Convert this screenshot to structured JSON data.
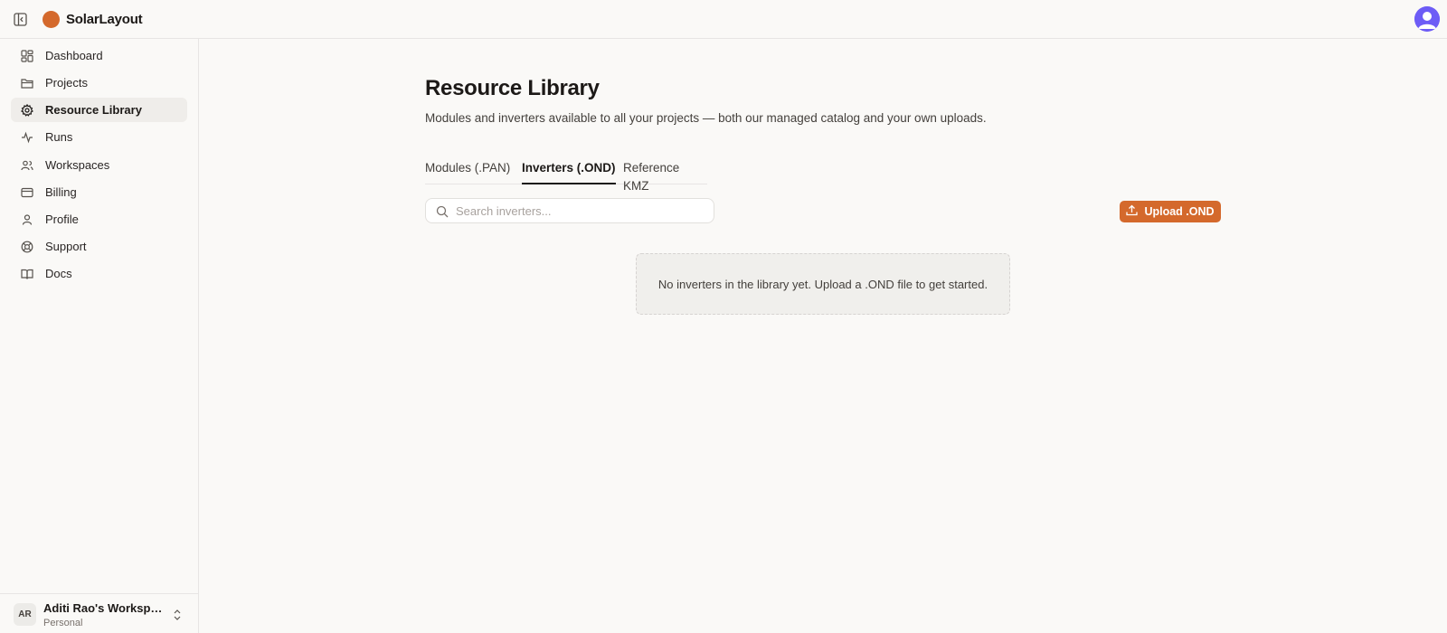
{
  "app": {
    "title": "SolarLayout",
    "brand_color": "#d4692c"
  },
  "header": {
    "sidebar_toggle_icon": "sidebar-toggle-icon",
    "user_avatar_color": "#6d5cf6"
  },
  "sidebar": {
    "items": [
      {
        "label": "Dashboard",
        "icon": "dashboard-grid-icon",
        "active": false
      },
      {
        "label": "Projects",
        "icon": "folder-icon",
        "active": false
      },
      {
        "label": "Resource Library",
        "icon": "gear-icon",
        "active": true
      },
      {
        "label": "Runs",
        "icon": "activity-icon",
        "active": false
      },
      {
        "label": "Workspaces",
        "icon": "users-icon",
        "active": false
      },
      {
        "label": "Billing",
        "icon": "credit-card-icon",
        "active": false
      },
      {
        "label": "Profile",
        "icon": "user-icon",
        "active": false
      },
      {
        "label": "Support",
        "icon": "life-buoy-icon",
        "active": false
      },
      {
        "label": "Docs",
        "icon": "book-open-icon",
        "active": false
      }
    ],
    "workspace": {
      "initials": "AR",
      "name": "Aditi Rao's Workspace",
      "type": "Personal"
    }
  },
  "main": {
    "title": "Resource Library",
    "subtitle": "Modules and inverters available to all your projects — both our managed catalog and your own uploads.",
    "tabs": [
      {
        "label": "Modules (.PAN)",
        "active": false
      },
      {
        "label": "Inverters (.OND)",
        "active": true
      },
      {
        "label": "Reference KMZ",
        "active": false
      }
    ],
    "search": {
      "placeholder": "Search inverters...",
      "value": ""
    },
    "upload_button_label": "Upload .OND",
    "empty_state": "No inverters in the library yet. Upload a .OND file to get started."
  }
}
